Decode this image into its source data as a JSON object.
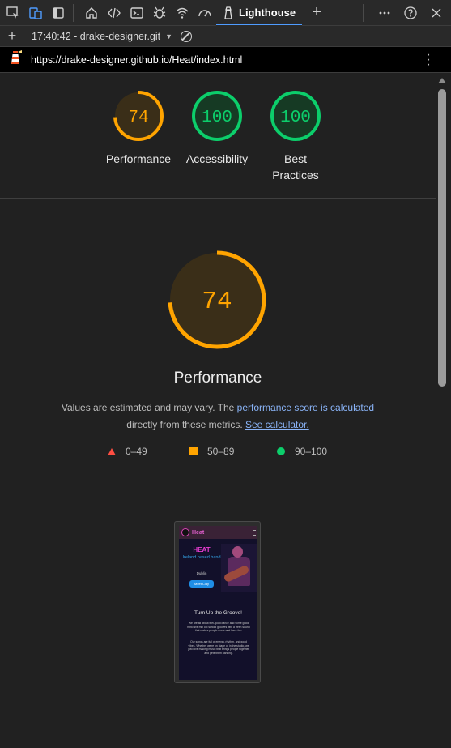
{
  "toolbar": {
    "icons": [
      "inspect-icon",
      "device-emulation-icon",
      "dock-icon",
      "welcome-icon",
      "elements-icon",
      "console-icon",
      "sources-icon",
      "network-icon",
      "performance-icon"
    ],
    "active_tab": "Lighthouse",
    "more_tools": "+",
    "right_icons": [
      "more-icon",
      "help-icon",
      "close-icon"
    ]
  },
  "report_bar": {
    "new_report": "+",
    "selected_report": "17:40:42 - drake-designer.git"
  },
  "url_bar": {
    "url": "https://drake-designer.github.io/Heat/index.html"
  },
  "summary": [
    {
      "score": "74",
      "label": "Performance",
      "fraction": 0.74,
      "color": "#ffa400",
      "fill": "#3a2e18"
    },
    {
      "score": "100",
      "label": "Accessibility",
      "fraction": 1.0,
      "color": "#0cce6b",
      "fill": "#163a24"
    },
    {
      "score": "100",
      "label": "Best Practices",
      "fraction": 1.0,
      "color": "#0cce6b",
      "fill": "#163a24"
    }
  ],
  "performance": {
    "score": "74",
    "fraction": 0.74,
    "color": "#ffa400",
    "title": "Performance",
    "desc_text_1": "Values are estimated and may vary. The ",
    "desc_link_1": "performance score is calculated",
    "desc_text_2": "directly from these metrics.",
    "desc_link_2": "See calculator."
  },
  "legend": [
    {
      "range": "0–49",
      "color": "#ff4e42",
      "shape": "triangle"
    },
    {
      "range": "50–89",
      "color": "#ffa400",
      "shape": "square"
    },
    {
      "range": "90–100",
      "color": "#0cce6b",
      "shape": "circle"
    }
  ],
  "screenshot": {
    "brand": "Heat",
    "heading": "HEAT",
    "subheading": "Ireland based band",
    "city": "Dublin",
    "button": "Meet Clay",
    "tagline": "Turn Up the Groove!",
    "para1": "We are all about feel-good dance and some good funk! We mix old school grooves with a fresh sound that makes people move and have fun.",
    "para2": "Our songs are full of energy, rhythm, and good vibes. Whether we're on stage or in the studio, we just love making music that brings people together and gets them dancing."
  }
}
